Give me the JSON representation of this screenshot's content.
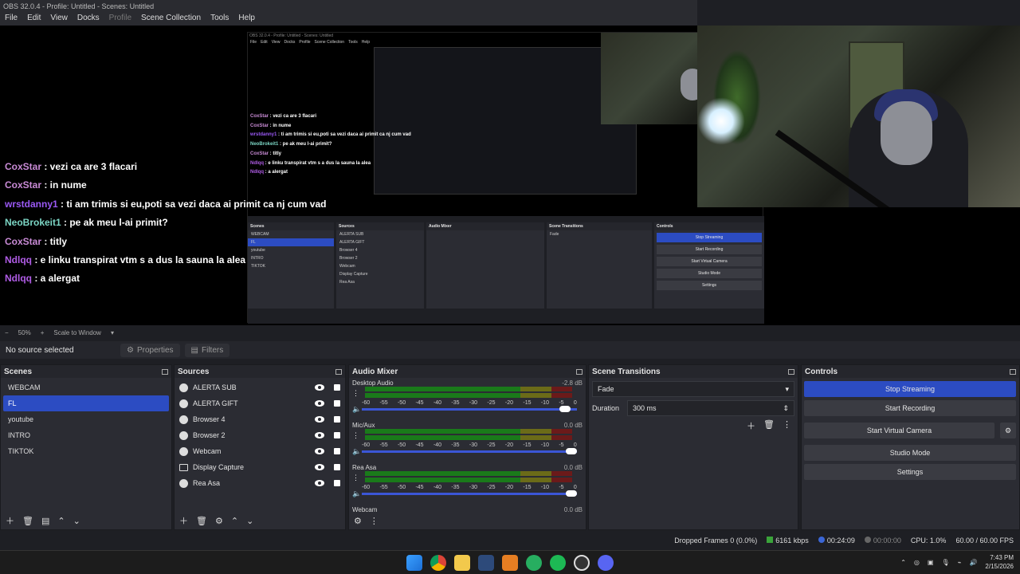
{
  "window": {
    "title": "OBS 32.0.4 - Profile: Untitled - Scenes: Untitled"
  },
  "menu": [
    "File",
    "Edit",
    "View",
    "Docks",
    "Profile",
    "Scene Collection",
    "Tools",
    "Help"
  ],
  "chat": [
    {
      "user": "CoxStar",
      "text": " : vezi ca are 3 flacari",
      "color": "#c98bd6"
    },
    {
      "user": "CoxStar",
      "text": " : in nume",
      "color": "#c98bd6"
    },
    {
      "user": "wrstdanny1",
      "text": " : ti am trimis si eu,poti sa vezi daca ai primit ca nj cum vad",
      "color": "#9b59f5"
    },
    {
      "user": "NeoBrokeit1",
      "text": " : pe ak meu l-ai primit?",
      "color": "#7cd6c5"
    },
    {
      "user": "CoxStar",
      "text": " : titly",
      "color": "#c98bd6"
    },
    {
      "user": "Ndlqq",
      "text": " : e linku transpirat vtm s a dus la sauna la alea",
      "color": "#b05ce6"
    },
    {
      "user": "Ndlqq",
      "text": " : a alergat",
      "color": "#b05ce6"
    }
  ],
  "zoom": {
    "minus": "−",
    "value": "50%",
    "plus": "+",
    "mode": "Scale to Window"
  },
  "source_bar": {
    "status": "No source selected",
    "properties": "Properties",
    "filters": "Filters"
  },
  "scenes": {
    "title": "Scenes",
    "items": [
      "WEBCAM",
      "FL",
      "youtube",
      "INTRO",
      "TIKTOK"
    ],
    "selected": 1
  },
  "sources": {
    "title": "Sources",
    "items": [
      {
        "name": "ALERTA SUB",
        "icon": "browser-icon"
      },
      {
        "name": "ALERTA GIFT",
        "icon": "browser-icon"
      },
      {
        "name": "Browser 4",
        "icon": "browser-icon"
      },
      {
        "name": "Browser 2",
        "icon": "browser-icon"
      },
      {
        "name": "Webcam",
        "icon": "camera-icon"
      },
      {
        "name": "Display Capture",
        "icon": "monitor-icon"
      },
      {
        "name": "Rea Asa",
        "icon": "microphone-icon"
      }
    ]
  },
  "mixer": {
    "title": "Audio Mixer",
    "ticks": [
      "-60",
      "-55",
      "-50",
      "-45",
      "-40",
      "-35",
      "-30",
      "-25",
      "-20",
      "-15",
      "-10",
      "-5",
      "0"
    ],
    "channels": [
      {
        "name": "Desktop Audio",
        "db": "-2.8 dB",
        "level": 0.97
      },
      {
        "name": "Mic/Aux",
        "db": "0.0 dB",
        "level": 1.0
      },
      {
        "name": "Rea Asa",
        "db": "0.0 dB",
        "level": 1.0
      },
      {
        "name": "Webcam",
        "db": "0.0 dB",
        "level": 1.0
      }
    ]
  },
  "transitions": {
    "title": "Scene Transitions",
    "selected": "Fade",
    "duration_label": "Duration",
    "duration_value": "300 ms"
  },
  "controls": {
    "title": "Controls",
    "stream": "Stop Streaming",
    "record": "Start Recording",
    "vcam": "Start Virtual Camera",
    "studio": "Studio Mode",
    "settings": "Settings"
  },
  "status": {
    "dropped": "Dropped Frames 0 (0.0%)",
    "bitrate": "6161 kbps",
    "stream_time": "00:24:09",
    "rec_time": "00:00:00",
    "cpu": "CPU: 1.0%",
    "fps": "60.00 / 60.00 FPS"
  },
  "clock": {
    "time": "7:43 PM",
    "date": "2/15/2026"
  },
  "colors": {
    "accent": "#2c4cc2",
    "panel": "#2b2c33",
    "bg": "#1e1f24"
  }
}
